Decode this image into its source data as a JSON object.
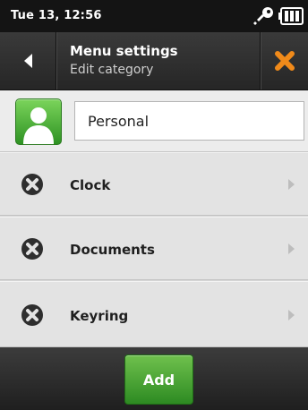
{
  "status_bar": {
    "time": "Tue 13, 12:56",
    "icons": [
      "key-icon",
      "battery-icon"
    ]
  },
  "header": {
    "title": "Menu settings",
    "subtitle": "Edit category",
    "back_icon": "back-arrow-icon",
    "close_icon": "close-x-icon"
  },
  "category": {
    "icon": "person-icon",
    "name_value": "Personal"
  },
  "items": [
    {
      "label": "Clock",
      "icon": "remove-icon",
      "chevron": "chevron-right-icon"
    },
    {
      "label": "Documents",
      "icon": "remove-icon",
      "chevron": "chevron-right-icon"
    },
    {
      "label": "Keyring",
      "icon": "remove-icon",
      "chevron": "chevron-right-icon"
    }
  ],
  "footer": {
    "add_label": "Add"
  },
  "colors": {
    "accent_green": "#3fa02e",
    "close_orange": "#f08a1a",
    "status_bar_bg": "#141414",
    "list_bg": "#e3e3e3"
  }
}
